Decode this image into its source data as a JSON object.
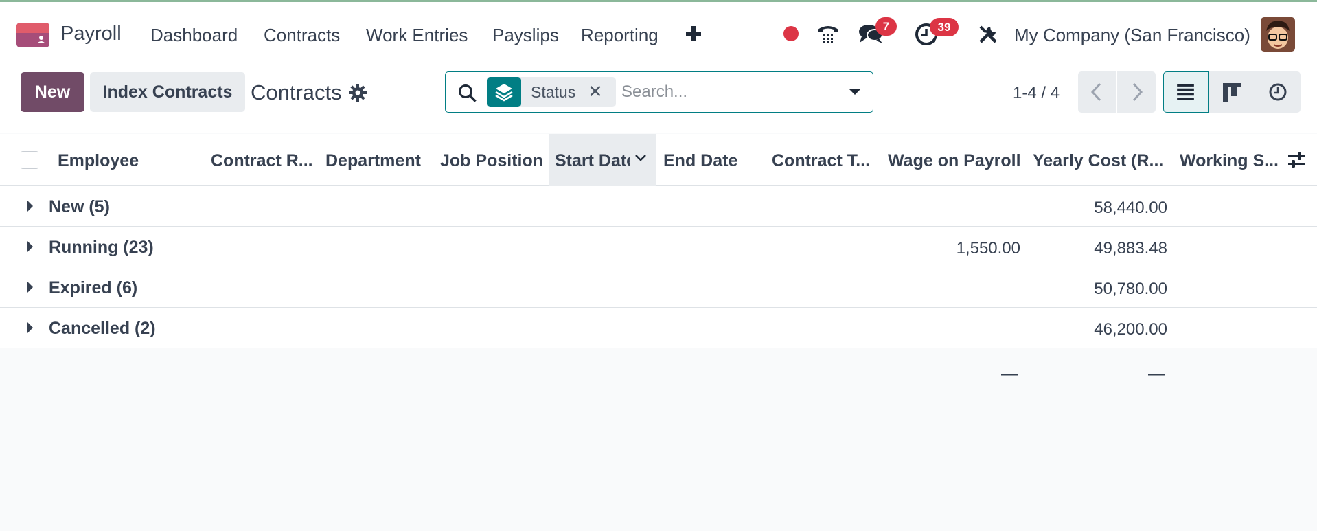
{
  "app": {
    "name": "Payroll"
  },
  "nav": {
    "menu": [
      "Dashboard",
      "Contracts",
      "Work Entries",
      "Payslips",
      "Reporting"
    ],
    "messages_badge": "7",
    "activities_badge": "39",
    "company": "My Company (San Francisco)"
  },
  "control_panel": {
    "new_label": "New",
    "index_label": "Index Contracts",
    "title": "Contracts",
    "facet_label": "Status",
    "search_placeholder": "Search...",
    "pager": "1-4 / 4"
  },
  "table": {
    "columns": [
      "Employee",
      "Contract R...",
      "Department",
      "Job Position",
      "Start Date",
      "End Date",
      "Contract T...",
      "Wage on Payroll",
      "Yearly Cost (R...",
      "Working S..."
    ],
    "groups": [
      {
        "label": "New (5)",
        "wage": "",
        "yearly": "58,440.00"
      },
      {
        "label": "Running (23)",
        "wage": "1,550.00",
        "yearly": "49,883.48"
      },
      {
        "label": "Expired (6)",
        "wage": "",
        "yearly": "50,780.00"
      },
      {
        "label": "Cancelled (2)",
        "wage": "",
        "yearly": "46,200.00"
      }
    ],
    "footer_wage": "—",
    "footer_yearly": "—"
  },
  "colors": {
    "brand": "#714b67",
    "accent": "#017e84",
    "badge": "#dc3545"
  }
}
